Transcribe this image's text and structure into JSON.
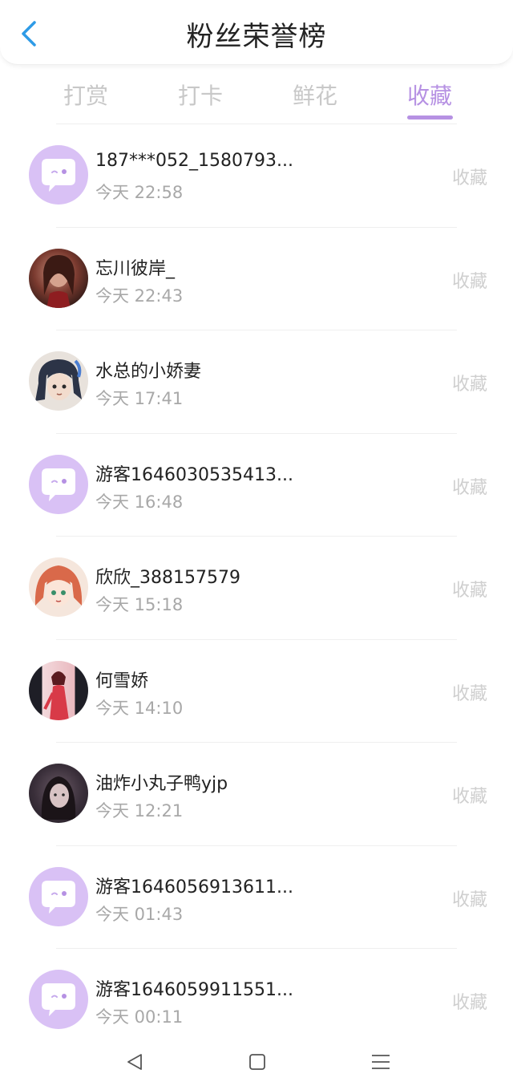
{
  "header": {
    "title": "粉丝荣誉榜"
  },
  "tabs": [
    {
      "label": "打赏"
    },
    {
      "label": "打卡"
    },
    {
      "label": "鲜花"
    },
    {
      "label": "收藏"
    }
  ],
  "active_tab": "收藏",
  "fans": [
    {
      "name": "187***052_1580793...",
      "time": "今天 22:58",
      "action": "收藏",
      "avatar": "default"
    },
    {
      "name": "忘川彼岸_",
      "time": "今天 22:43",
      "action": "收藏",
      "avatar": "photo-dark-red"
    },
    {
      "name": "水总的小娇妻",
      "time": "今天 17:41",
      "action": "收藏",
      "avatar": "anime-blue-hair"
    },
    {
      "name": "游客1646030535413...",
      "time": "今天 16:48",
      "action": "收藏",
      "avatar": "default"
    },
    {
      "name": "欣欣_388157579",
      "time": "今天 15:18",
      "action": "收藏",
      "avatar": "anime-orange-hair"
    },
    {
      "name": "何雪娇",
      "time": "今天 14:10",
      "action": "收藏",
      "avatar": "photo-red-dress"
    },
    {
      "name": "油炸小丸子鸭yjp",
      "time": "今天 12:21",
      "action": "收藏",
      "avatar": "photo-girl-dark"
    },
    {
      "name": "游客1646056913611...",
      "time": "今天 01:43",
      "action": "收藏",
      "avatar": "default"
    },
    {
      "name": "游客1646059911551...",
      "time": "今天 00:11",
      "action": "收藏",
      "avatar": "default"
    }
  ],
  "colors": {
    "accent": "#b691e3",
    "back_arrow": "#2e9be6",
    "default_avatar": "#d9c1f5"
  },
  "navbar": {
    "icons": [
      "back-triangle-icon",
      "home-square-icon",
      "menu-lines-icon"
    ]
  }
}
